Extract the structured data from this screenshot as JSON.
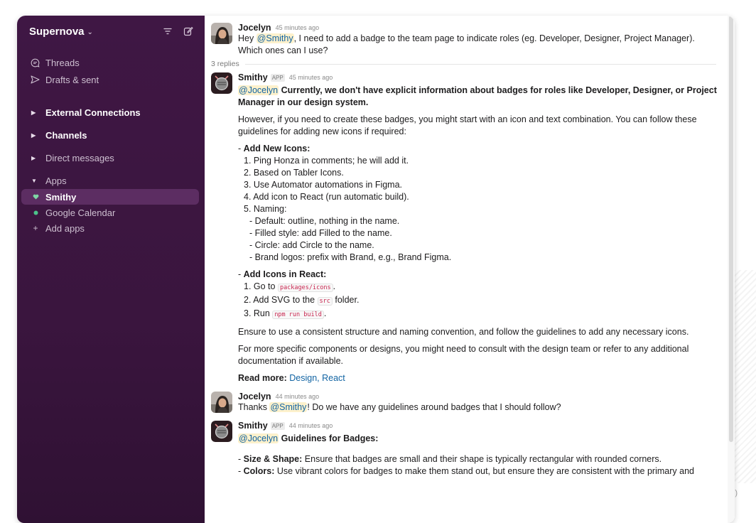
{
  "sidebar": {
    "workspace": "Supernova",
    "nav": [
      {
        "label": "Threads",
        "icon": "threads-icon"
      },
      {
        "label": "Drafts & sent",
        "icon": "send-icon"
      }
    ],
    "sections": {
      "external": "External Connections",
      "channels": "Channels",
      "dms": "Direct messages",
      "apps": "Apps"
    },
    "apps": [
      {
        "label": "Smithy",
        "icon": "heart-icon",
        "active": true
      },
      {
        "label": "Google Calendar",
        "icon": "dot-icon",
        "active": false
      },
      {
        "label": "Add apps",
        "icon": "plus-icon",
        "active": false
      }
    ]
  },
  "colors": {
    "sidebar_bg": "#3f1744",
    "active_item": "#5c2d62",
    "link": "#1264a3",
    "mention_bg": "#fdf1cc"
  },
  "messages": {
    "m1": {
      "author": "Jocelyn",
      "time": "45 minutes ago",
      "text_pre": "Hey ",
      "mention": "@Smithy",
      "text_post": ", I need to add a badge to the team page to indicate roles (eg. Developer, Designer, Project Manager). Which ones can I use?"
    },
    "replies": "3 replies",
    "m2": {
      "author": "Smithy",
      "app_badge": "APP",
      "time": "45 minutes ago",
      "mention": "@Jocelyn",
      "lead": "Currently, we don't have explicit information about badges for roles like Developer, Designer, or Project Manager in our design system.",
      "p1": "However, if you need to create these badges, you might start with an icon and text combination. You can follow these guidelines for adding new icons if required:",
      "h1": "Add New Icons:",
      "h1_prefix": "- ",
      "list1": [
        "1. Ping Honza in comments; he will add it.",
        "2. Based on Tabler Icons.",
        "3. Use Automator automations in Figma.",
        "4. Add icon to React (run automatic build).",
        "5. Naming:"
      ],
      "naming": [
        "- Default: outline, nothing in the name.",
        "- Filled style: add Filled to the name.",
        "- Circle: add Circle to the name.",
        "- Brand logos: prefix with Brand, e.g., Brand Figma."
      ],
      "h2": "Add Icons in React:",
      "h2_prefix": "- ",
      "r1_pre": "1. Go to ",
      "r1_code": "packages/icons",
      "r1_post": ".",
      "r2_pre": "2. Add SVG to the ",
      "r2_code": "src",
      "r2_post": " folder.",
      "r3_pre": "3. Run ",
      "r3_code": "npm run build",
      "r3_post": ".",
      "p2": "Ensure to use a consistent structure and naming convention, and follow the guidelines to add any necessary icons.",
      "p3": "For more specific components or designs, you might need to consult with the design team or refer to any additional documentation if available.",
      "read_more_label": "Read more:",
      "read_more_links": " Design, React"
    },
    "m3": {
      "author": "Jocelyn",
      "time": "44 minutes ago",
      "text_pre": "Thanks ",
      "mention": "@Smithy",
      "text_post": "! Do we have any guidelines around badges that I should follow?"
    },
    "m4": {
      "author": "Smithy",
      "app_badge": "APP",
      "time": "44 minutes ago",
      "mention": "@Jocelyn",
      "lead": "Guidelines for Badges:",
      "b1_label": "Size & Shape:",
      "b1_text": " Ensure that badges are small and their shape is typically rectangular with rounded corners.",
      "b2_label": "Colors:",
      "b2_text": " Use vibrant colors for badges to make them stand out, but ensure they are consistent with the primary and"
    }
  }
}
